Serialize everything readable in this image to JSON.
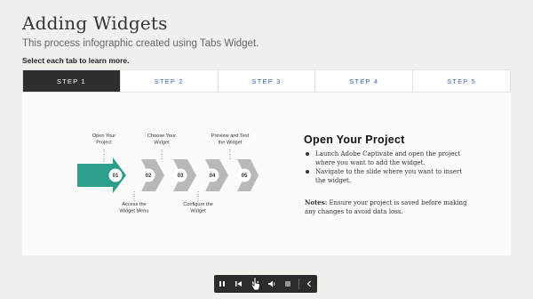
{
  "header": {
    "title": "Adding Widgets",
    "subtitle": "This process infographic created using Tabs Widget.",
    "instruction": "Select each tab to learn more."
  },
  "tabs": [
    {
      "label": "STEP 1",
      "active": true
    },
    {
      "label": "STEP 2",
      "active": false
    },
    {
      "label": "STEP 3",
      "active": false
    },
    {
      "label": "STEP 4",
      "active": false
    },
    {
      "label": "STEP 5",
      "active": false
    }
  ],
  "diagram": {
    "steps": [
      "01",
      "02",
      "03",
      "04",
      "05"
    ],
    "labels": {
      "s1": [
        "Open Your",
        "Project"
      ],
      "s2": [
        "Access the",
        "Widget Menu"
      ],
      "s3": [
        "Choose Your",
        "Widget"
      ],
      "s4": [
        "Configure the",
        "Widget"
      ],
      "s5": [
        "Preview and Test",
        "the Widget"
      ]
    },
    "colors": {
      "active": "#2e9e8c",
      "inactive": "#b8b8b8"
    }
  },
  "content": {
    "title": "Open Your Project",
    "bullets": [
      "Launch Adobe Captivate and open the project where you want to add the widget.",
      "Navigate to the slide where you want to insert the widget."
    ],
    "notes_label": "Notes:",
    "notes_text": " Ensure your project is saved before making any changes to avoid data loss."
  },
  "player": {
    "buttons": [
      "pause-icon",
      "rewind-icon",
      "play-icon",
      "volume-icon",
      "menu-icon",
      "collapse-icon"
    ]
  }
}
